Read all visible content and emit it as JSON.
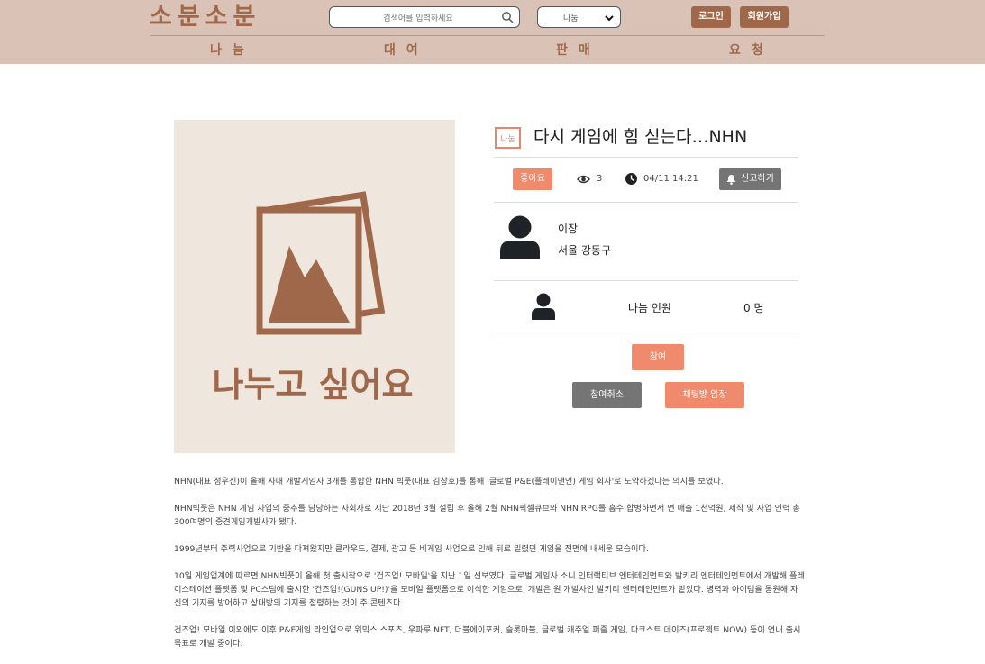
{
  "header": {
    "logo": "소분소분",
    "search_placeholder": "검색어를 입력하세요",
    "category_select": "나눔",
    "login_label": "로그인",
    "signup_label": "회원가입",
    "nav": [
      "나눔",
      "대여",
      "판매",
      "요청"
    ]
  },
  "post": {
    "image_caption": "나누고 싶어요",
    "category_badge": "나눔",
    "title": "다시 게임에 힘 싣는다…NHN",
    "like_label": "좋아요",
    "views": "3",
    "datetime": "04/11 14:21",
    "report_label": "신고하기",
    "author_name": "이장",
    "author_location": "서울 강동구",
    "share_people_label": "나눔 인원",
    "share_people_count": "0 명",
    "join_label": "참여",
    "cancel_join_label": "참여취소",
    "chat_label": "채팅방 입장",
    "body": [
      "NHN(대표 정우진)이 올해 사내 개발게임사 3개를 통합한 NHN 빅풋(대표 김상호)를 통해 '글로벌 P&E(플레이앤언) 게임 회사'로 도약하겠다는 의지를 보였다.",
      "NHN빅풋은 NHN 게임 사업의 중추를 담당하는 자회사로 지난 2018년 3월 설립 후 올해 2월 NHN픽셀큐브와 NHN RPG를 흡수 합병하면서 연 매출 1천억원, 제작 및 사업 인력 총 300여명의 중견게임개발사가 됐다.",
      "1999년부터 주력사업으로 기반을 다져왔지만 클라우드, 결제, 광고 등 비게임 사업으로 인해 뒤로 밀렸던 게임을 전면에 내세운 모습이다.",
      "10일 게임업계에 따르면 NHN빅풋이 올해 첫 출시작으로 '건즈업! 모바일'을 지난 1일 선보였다. 글로벌 게임사 소니 인터랙티브 엔터테인먼트와 발키리 엔터테인먼트에서 개발해 플레이스테이션 플랫폼 및 PC스팀에 출시한 '건즈업!(GUNS UP!)'을 모바일 플랫폼으로 이식한 게임으로, 개발은 원 개발사인 발키리 엔터테인먼트가 맡았다. 병력과 아이템을 동원해 자신의 기지를 방어하고 상대방의 기지를 점령하는 것이 주 콘텐츠다.",
      "건즈업! 모바일 이외에도 이후 P&E게임 라인업으로 위믹스 스포츠, 우파루 NFT, 더블에이포커, 슬롯마블, 글로벌 캐주얼 퍼즐 게임, 다크스트 데이즈(프로젝트 NOW) 등이 연내 출시 목표로 개발 중이다."
    ]
  },
  "colors": {
    "header_bg": "#dbc2b6",
    "brand_brown": "#a0684a",
    "accent_coral": "#ef8a6c",
    "gray_button": "#757575"
  }
}
